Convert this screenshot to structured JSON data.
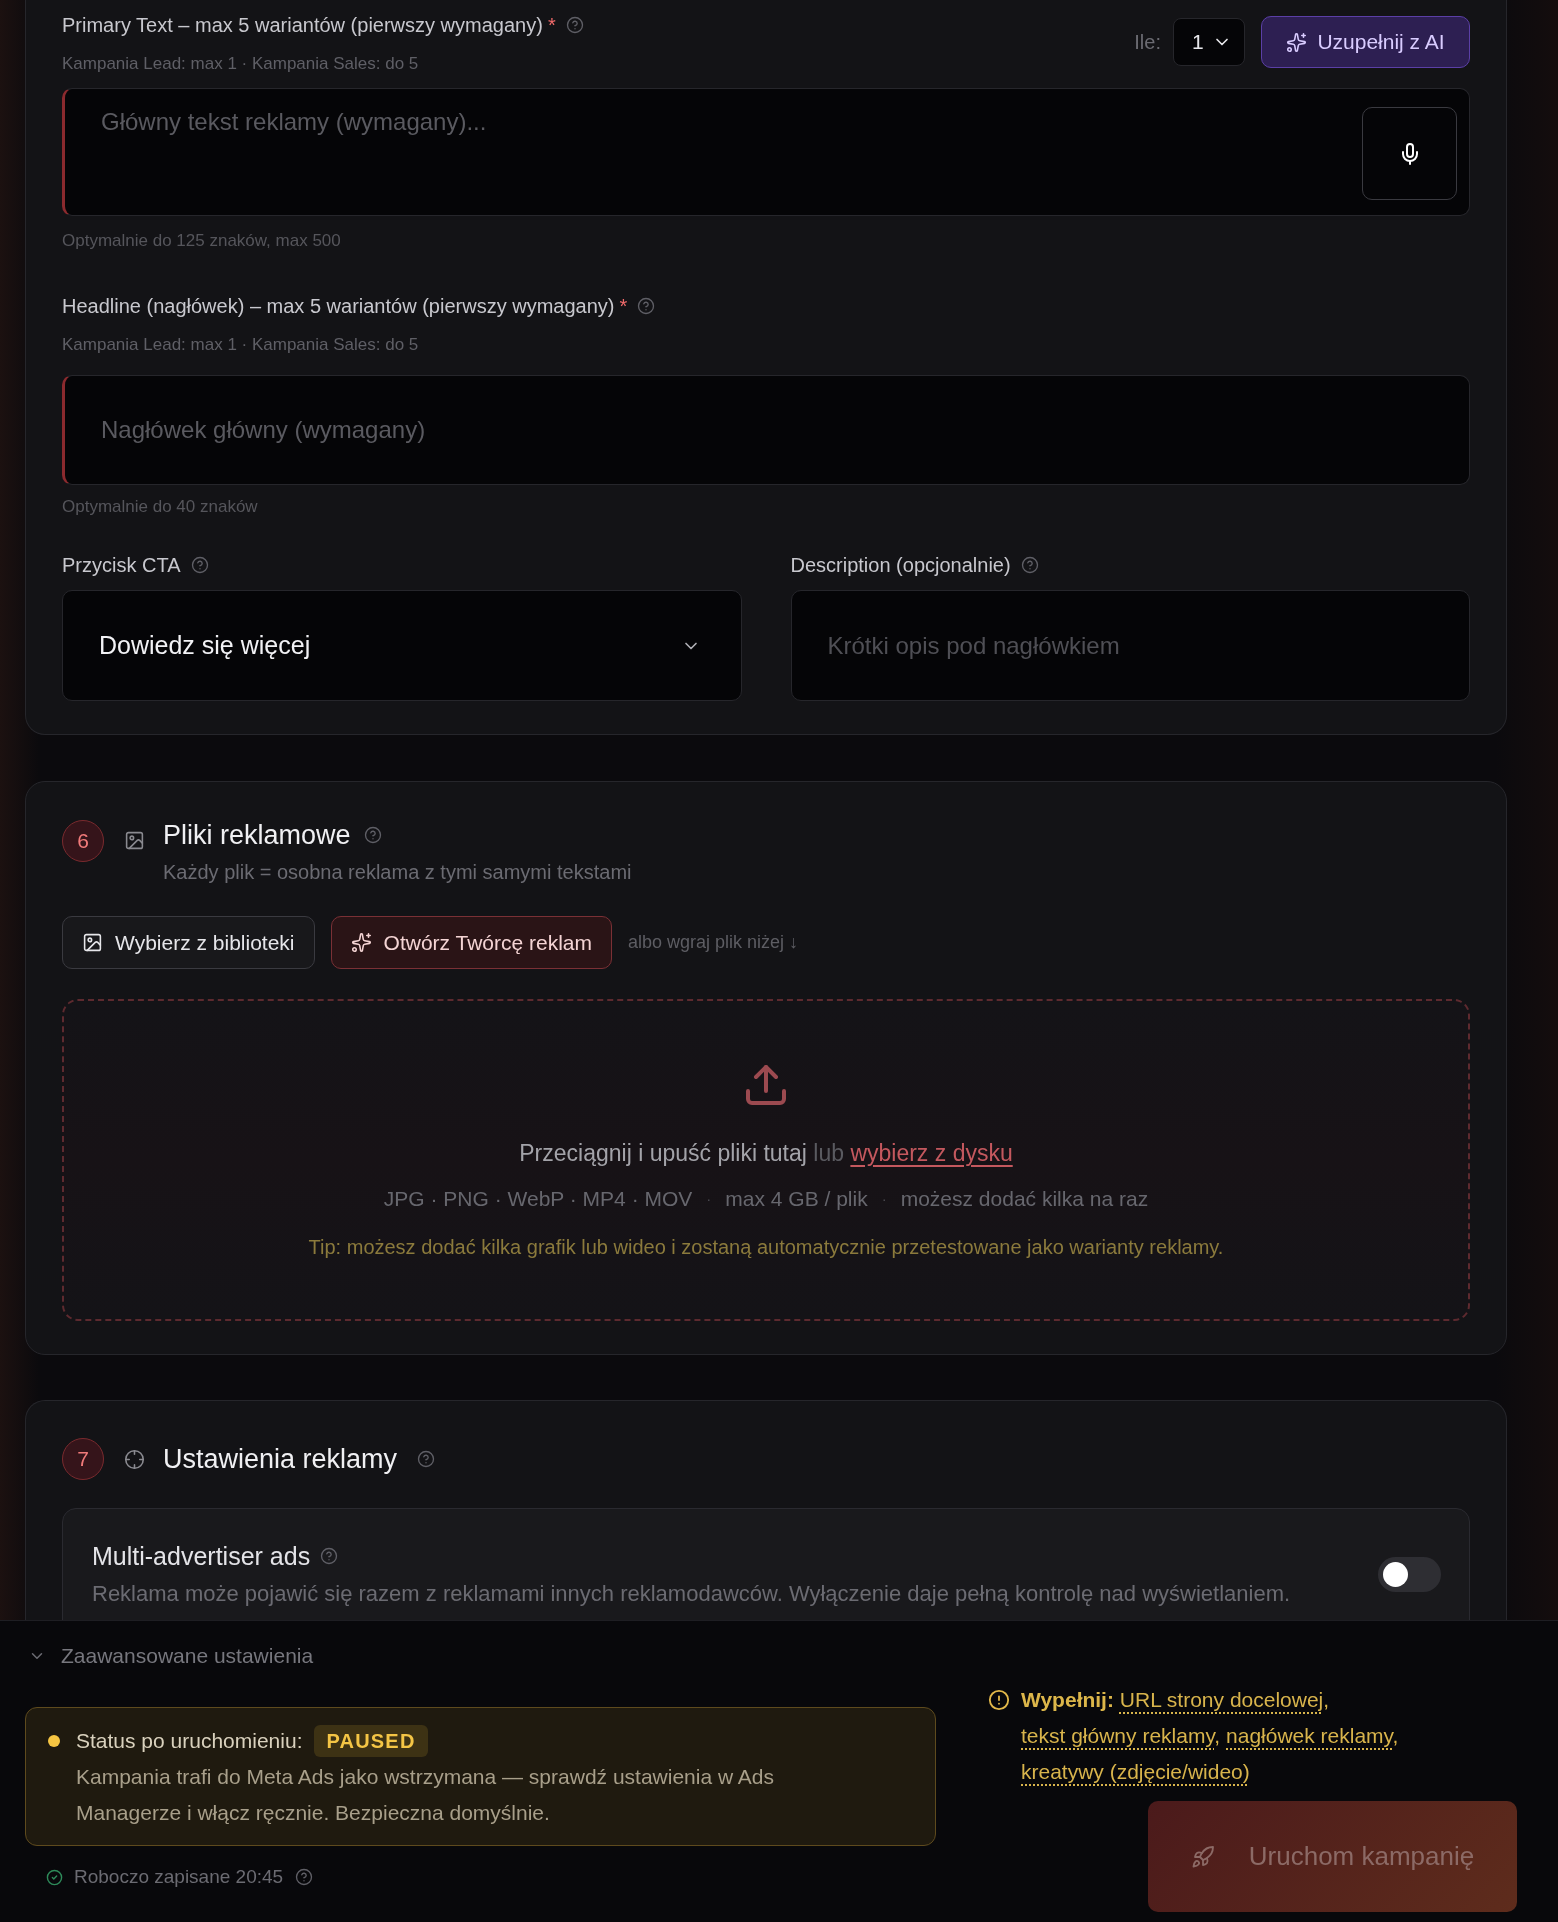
{
  "primary_text": {
    "label": "Primary Text – max 5 wariantów (pierwszy wymagany)",
    "required_mark": "*",
    "hint": "Kampania Lead: max 1 · Kampania Sales: do 5",
    "count": {
      "label": "Ile:",
      "value": "1"
    },
    "ai_button": "Uzupełnij z AI",
    "placeholder": "Główny tekst reklamy (wymagany)...",
    "invalid": true,
    "note": "Optymalnie do 125 znaków, max 500"
  },
  "headline": {
    "label": "Headline (nagłówek) – max 5 wariantów (pierwszy wymagany)",
    "required_mark": "*",
    "hint": "Kampania Lead: max 1 · Kampania Sales: do 5",
    "placeholder": "Nagłówek główny (wymagany)",
    "invalid": true,
    "note": "Optymalnie do 40 znaków"
  },
  "cta": {
    "label": "Przycisk CTA",
    "value": "Dowiedz się więcej"
  },
  "description": {
    "label": "Description (opcjonalnie)",
    "placeholder": "Krótki opis pod nagłówkiem"
  },
  "files_section": {
    "number": "6",
    "title": "Pliki reklamowe",
    "subtitle": "Każdy plik = osobna reklama z tymi samymi tekstami",
    "buttons": [
      {
        "kind": "library",
        "label": "Wybierz z biblioteki"
      },
      {
        "kind": "creator",
        "label": "Otwórz Twórcę reklam"
      }
    ],
    "upload_note": "albo wgraj plik niżej ↓",
    "dropzone": {
      "text": "Przeciągnij i upuść pliki tutaj",
      "connector": "lub",
      "link": "wybierz z dysku",
      "details": [
        {
          "text": "JPG · PNG · WebP · MP4 · MOV"
        },
        {
          "separator": "·",
          "text": "max 4 GB / plik"
        },
        {
          "separator": "·",
          "text": "możesz dodać kilka na raz"
        }
      ],
      "tip": "Tip: możesz dodać kilka grafik lub wideo i zostaną automatycznie przetestowane jako warianty reklamy."
    }
  },
  "settings_section": {
    "number": "7",
    "title": "Ustawienia reklamy",
    "options": [
      {
        "title": "Multi-advertiser ads",
        "description": "Reklama może pojawić się razem z reklamami innych reklamodawców. Wyłączenie daje pełną kontrolę nad wyświetlaniem.",
        "on": false
      }
    ]
  },
  "footer": {
    "advanced": {
      "label": "Zaawansowane ustawienia",
      "expanded": false
    },
    "status": {
      "label": "Status po uruchomieniu:",
      "badge": "PAUSED",
      "description": "Kampania trafi do Meta Ads jako wstrzymana — sprawdź ustawienia w Ads Managerze i włącz ręcznie. Bezpieczna domyślnie."
    },
    "draft": "Roboczo zapisane 20:45",
    "missing": {
      "label": "Wypełnij:",
      "items": [
        {
          "text": "URL strony docelowej",
          "separator": ","
        },
        {
          "text": "tekst główny reklamy",
          "separator": ","
        },
        {
          "text": "nagłówek reklamy",
          "separator": ","
        },
        {
          "text": "kreatywy (zdjęcie/wideo)"
        }
      ]
    },
    "launch": {
      "label": "Uruchom kampanię",
      "disabled": true
    }
  }
}
